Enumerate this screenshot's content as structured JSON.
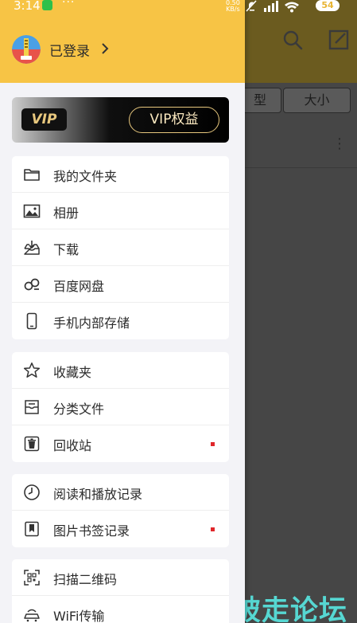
{
  "status_bar": {
    "time": "3:14",
    "dots": "···",
    "net_speed_value": "0.50",
    "net_speed_unit": "KB/s",
    "battery": "54"
  },
  "background_app": {
    "tab_type_partial": "型",
    "tab_size": "大小"
  },
  "drawer": {
    "login_label": "已登录",
    "vip": {
      "logo_text": "VIP",
      "button_label": "VIP权益"
    },
    "groups": [
      {
        "items": [
          {
            "label": "我的文件夹",
            "icon": "folder-icon"
          },
          {
            "label": "相册",
            "icon": "image-icon"
          },
          {
            "label": "下载",
            "icon": "download-tray-icon"
          },
          {
            "label": "百度网盘",
            "icon": "cloud-link-icon"
          },
          {
            "label": "手机内部存储",
            "icon": "phone-icon"
          }
        ]
      },
      {
        "items": [
          {
            "label": "收藏夹",
            "icon": "star-icon"
          },
          {
            "label": "分类文件",
            "icon": "inbox-icon"
          },
          {
            "label": "回收站",
            "icon": "trash-icon",
            "red_dot": true
          }
        ]
      },
      {
        "items": [
          {
            "label": "阅读和播放记录",
            "icon": "clock-icon"
          },
          {
            "label": "图片书签记录",
            "icon": "bookmark-icon",
            "red_dot": true
          }
        ]
      },
      {
        "items": [
          {
            "label": "扫描二维码",
            "icon": "qr-scan-icon"
          },
          {
            "label": "WiFi传输",
            "icon": "wifi-transfer-icon"
          }
        ]
      }
    ]
  },
  "watermark": "破走论坛",
  "colors": {
    "header_yellow": "#f7c445",
    "vip_gold": "#e7c77d",
    "red_dot": "#e0262a",
    "watermark_cyan": "#56d7d2"
  }
}
